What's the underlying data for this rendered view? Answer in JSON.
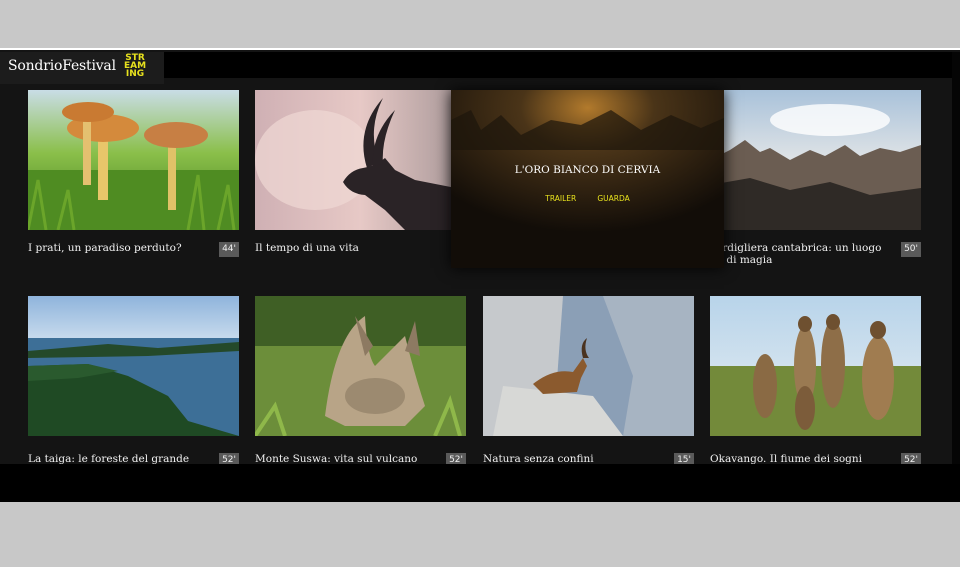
{
  "header": {
    "logo_name": "SondrioFestival",
    "logo_small": "ondrio",
    "logo_streaming": "STREAMING",
    "logo_sub": ""
  },
  "featured": {
    "title": "L'ORO BIANCO DI CERVIA",
    "trailer_label": "TRAILER",
    "watch_label": "GUARDA"
  },
  "row1": [
    {
      "title": "I prati, un paradiso perduto?",
      "duration": "44'"
    },
    {
      "title": "Il tempo di una vita",
      "duration": ""
    },
    {
      "title": "",
      "duration": ""
    },
    {
      "title": "cordigliera cantabrica: un luogo\nno di magia",
      "duration": "50'"
    }
  ],
  "row2": [
    {
      "title": "La taiga: le foreste del grande nord",
      "duration": "52'"
    },
    {
      "title": "Monte Suswa: vita sul vulcano",
      "duration": "52'"
    },
    {
      "title": "Natura senza confini",
      "duration": "15'"
    },
    {
      "title": "Okavango. Il fiume dei sogni",
      "duration": "52'"
    }
  ],
  "colors": {
    "accent": "#e7e11e",
    "background": "#141414"
  }
}
